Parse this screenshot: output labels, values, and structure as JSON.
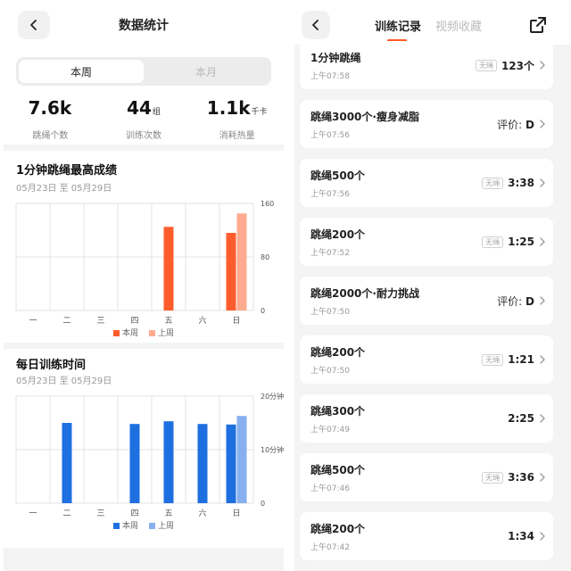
{
  "left": {
    "title": "数据统计",
    "segment": {
      "active": "本周",
      "inactive": "本月"
    },
    "stats": [
      {
        "value": "7.6k",
        "unit": "",
        "label": "跳绳个数"
      },
      {
        "value": "44",
        "unit": "组",
        "label": "训练次数"
      },
      {
        "value": "1.1k",
        "unit": "千卡",
        "label": "消耗热量"
      }
    ],
    "section1": {
      "title": "1分钟跳绳最高成绩",
      "date": "05月23日 至 05月29日"
    },
    "section2": {
      "title": "每日训练时间",
      "date": "05月23日 至 05月29日"
    }
  },
  "colors": {
    "orange_this": "#ff5c2e",
    "orange_last": "#ffab8f",
    "blue_this": "#1e6fe0",
    "blue_last": "#86b0ef",
    "accent": "#ff5722"
  },
  "chart_data": [
    {
      "type": "bar",
      "title": "1分钟跳绳最高成绩",
      "categories": [
        "一",
        "二",
        "三",
        "四",
        "五",
        "六",
        "日"
      ],
      "series": [
        {
          "name": "本周",
          "values": [
            0,
            0,
            0,
            0,
            125,
            0,
            116
          ]
        },
        {
          "name": "上周",
          "values": [
            0,
            0,
            0,
            0,
            0,
            0,
            145
          ]
        }
      ],
      "ylim": [
        0,
        160
      ],
      "yticks": [
        "0",
        "80",
        "160"
      ],
      "legend": [
        "本周",
        "上周"
      ],
      "grid": true
    },
    {
      "type": "bar",
      "title": "每日训练时间",
      "categories": [
        "一",
        "二",
        "三",
        "四",
        "五",
        "六",
        "日"
      ],
      "series": [
        {
          "name": "本周",
          "values": [
            0,
            15,
            0,
            14.8,
            15.3,
            14.8,
            14.7
          ]
        },
        {
          "name": "上周",
          "values": [
            0,
            0,
            0,
            0,
            0,
            0,
            16.3
          ]
        }
      ],
      "ylim": [
        0,
        20
      ],
      "yticks": [
        "0",
        "10分钟",
        "20分钟"
      ],
      "legend": [
        "本周",
        "上周"
      ],
      "grid": true
    }
  ],
  "right": {
    "tabs": [
      "训练记录",
      "视频收藏"
    ],
    "records": [
      {
        "name": "1分钟跳绳",
        "time": "上午07:58",
        "tag": "无绳",
        "value": "123个",
        "prefix": ""
      },
      {
        "name": "跳绳3000个·瘦身减脂",
        "time": "上午07:56",
        "tag": "",
        "value": "D",
        "prefix": "评价: "
      },
      {
        "name": "跳绳500个",
        "time": "上午07:56",
        "tag": "无绳",
        "value": "3:38",
        "prefix": ""
      },
      {
        "name": "跳绳200个",
        "time": "上午07:52",
        "tag": "无绳",
        "value": "1:25",
        "prefix": ""
      },
      {
        "name": "跳绳2000个·耐力挑战",
        "time": "上午07:50",
        "tag": "",
        "value": "D",
        "prefix": "评价: "
      },
      {
        "name": "跳绳200个",
        "time": "上午07:50",
        "tag": "无绳",
        "value": "1:21",
        "prefix": ""
      },
      {
        "name": "跳绳300个",
        "time": "上午07:49",
        "tag": "",
        "value": "2:25",
        "prefix": ""
      },
      {
        "name": "跳绳500个",
        "time": "上午07:46",
        "tag": "无绳",
        "value": "3:36",
        "prefix": ""
      },
      {
        "name": "跳绳200个",
        "time": "上午07:42",
        "tag": "",
        "value": "1:34",
        "prefix": ""
      }
    ]
  }
}
